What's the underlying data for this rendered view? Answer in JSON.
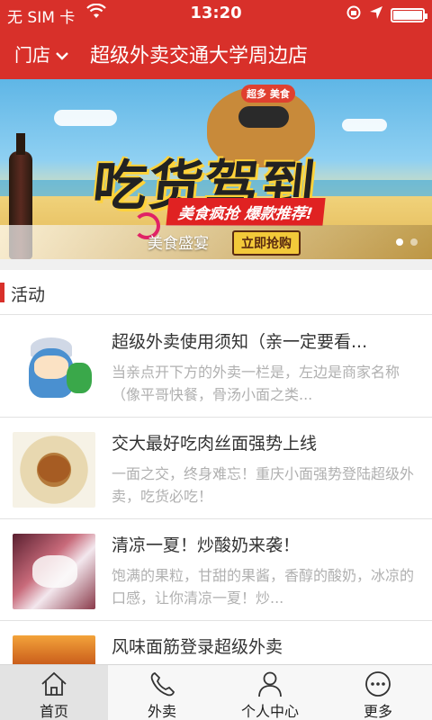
{
  "status_bar": {
    "carrier": "无 SIM 卡",
    "time": "13:20"
  },
  "header": {
    "store_label": "门店",
    "title": "超级外卖交通大学周边店"
  },
  "banner": {
    "headline": "吃货驾到",
    "slogan": "美食疯抢  爆款推荐!",
    "mascot_tag": "超多 美食",
    "caption": "美食盛宴",
    "buy_button": "立即抢购",
    "slide_count": 2,
    "active_slide": 1
  },
  "section": {
    "title": "活动"
  },
  "items": [
    {
      "title": "超级外卖使用须知（亲一定要看...",
      "desc": "当亲点开下方的外卖一栏是，左边是商家名称（像平哥快餐，骨汤小面之类..."
    },
    {
      "title": "交大最好吃肉丝面强势上线",
      "desc": "一面之交，终身难忘！重庆小面强势登陆超级外卖，吃货必吃！"
    },
    {
      "title": "清凉一夏！炒酸奶来袭！",
      "desc": "饱满的果粒，甘甜的果酱，香醇的酸奶，冰凉的口感，让你清凉一夏！炒..."
    },
    {
      "title": "风味面筋登录超级外卖",
      "desc": ""
    }
  ],
  "tabs": [
    {
      "label": "首页",
      "icon": "home-icon",
      "active": true
    },
    {
      "label": "外卖",
      "icon": "phone-icon",
      "active": false
    },
    {
      "label": "个人中心",
      "icon": "person-icon",
      "active": false
    },
    {
      "label": "更多",
      "icon": "more-icon",
      "active": false
    }
  ],
  "colors": {
    "brand_red": "#d8302a",
    "tab_active_bg": "#e3e3e3"
  }
}
